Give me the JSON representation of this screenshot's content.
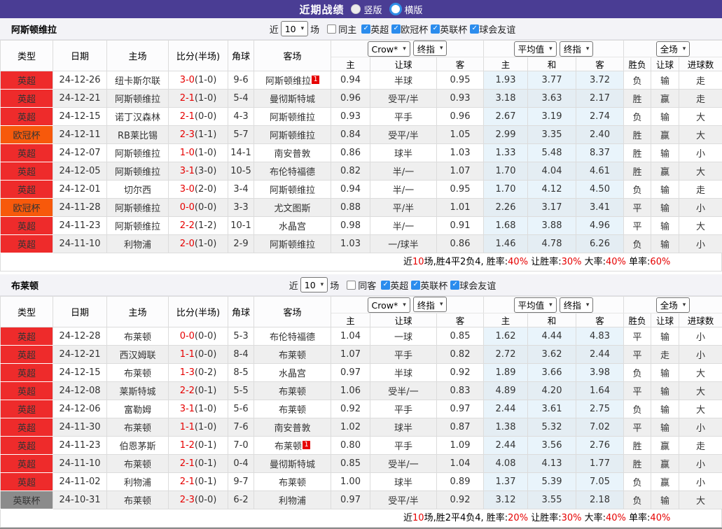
{
  "icons": {
    "check": "✓",
    "caret": "▾"
  },
  "colors": {
    "accent_purple": "#4a3d94",
    "league_red": "#ee2b2b",
    "league_orange": "#f7590b",
    "league_gray": "#8b8b8b",
    "team_highlight_green": "#2f9e2f",
    "score_red": "#e60000",
    "win_red": "#d43c3c",
    "lose_blue": "#3a3ad6",
    "draw_green": "#2e9b2e",
    "checkbox_blue": "#2b8ced"
  },
  "titlebar": {
    "title": "近期战绩",
    "radio_vertical": "竖版",
    "radio_horizontal": "横版"
  },
  "table_header": {
    "static_cols": [
      "类型",
      "日期",
      "主场",
      "比分(半场)",
      "角球",
      "客场"
    ],
    "crow_group": {
      "select1": "Crow*",
      "select2": "终指",
      "subcols": [
        "主",
        "让球",
        "客"
      ]
    },
    "avg_group": {
      "select1": "平均值",
      "select2": "终指",
      "subcols": [
        "主",
        "和",
        "客"
      ]
    },
    "result_group": {
      "select": "全场",
      "subcols": [
        "胜负",
        "让球",
        "进球数"
      ]
    }
  },
  "sections": [
    {
      "team": "阿斯顿维拉",
      "filter": {
        "prefix": "近",
        "match_count": "10",
        "suffix": "场",
        "same_label": "同主",
        "same_checked": false,
        "leagues": [
          {
            "label": "英超",
            "checked": true
          },
          {
            "label": "欧冠杯",
            "checked": true
          },
          {
            "label": "英联杯",
            "checked": true
          },
          {
            "label": "球会友谊",
            "checked": true
          }
        ]
      },
      "rows": [
        {
          "type": "英超",
          "style": "red",
          "date": "24-12-26",
          "home": "纽卡斯尔联",
          "home_green": false,
          "home_badge": null,
          "score": "3-0",
          "half": "(1-0)",
          "corner": "9-6",
          "away": "阿斯顿维拉",
          "away_green": true,
          "away_badge": "1",
          "crow": [
            "0.94",
            "半球",
            "0.95"
          ],
          "avg": [
            "1.93",
            "3.77",
            "3.72"
          ],
          "results": [
            [
              "负",
              "blue"
            ],
            [
              "输",
              "blue"
            ],
            [
              "走",
              "green"
            ]
          ]
        },
        {
          "type": "英超",
          "style": "red",
          "date": "24-12-21",
          "home": "阿斯顿维拉",
          "home_green": true,
          "home_badge": null,
          "score": "2-1",
          "half": "(1-0)",
          "corner": "5-4",
          "away": "曼彻斯特城",
          "away_green": false,
          "away_badge": null,
          "crow": [
            "0.96",
            "受平/半",
            "0.93"
          ],
          "avg": [
            "3.18",
            "3.63",
            "2.17"
          ],
          "results": [
            [
              "胜",
              "red"
            ],
            [
              "赢",
              "red"
            ],
            [
              "走",
              "green"
            ]
          ]
        },
        {
          "type": "英超",
          "style": "red",
          "date": "24-12-15",
          "home": "诺丁汉森林",
          "home_green": false,
          "home_badge": null,
          "score": "2-1",
          "half": "(0-0)",
          "corner": "4-3",
          "away": "阿斯顿维拉",
          "away_green": true,
          "away_badge": null,
          "crow": [
            "0.93",
            "平手",
            "0.96"
          ],
          "avg": [
            "2.67",
            "3.19",
            "2.74"
          ],
          "results": [
            [
              "负",
              "blue"
            ],
            [
              "输",
              "blue"
            ],
            [
              "大",
              "red"
            ]
          ]
        },
        {
          "type": "欧冠杯",
          "style": "orange",
          "date": "24-12-11",
          "home": "RB莱比锡",
          "home_green": false,
          "home_badge": null,
          "score": "2-3",
          "half": "(1-1)",
          "corner": "5-7",
          "away": "阿斯顿维拉",
          "away_green": true,
          "away_badge": null,
          "crow": [
            "0.84",
            "受平/半",
            "1.05"
          ],
          "avg": [
            "2.99",
            "3.35",
            "2.40"
          ],
          "results": [
            [
              "胜",
              "red"
            ],
            [
              "赢",
              "red"
            ],
            [
              "大",
              "red"
            ]
          ]
        },
        {
          "type": "英超",
          "style": "red",
          "date": "24-12-07",
          "home": "阿斯顿维拉",
          "home_green": true,
          "home_badge": null,
          "score": "1-0",
          "half": "(1-0)",
          "corner": "14-1",
          "away": "南安普敦",
          "away_green": false,
          "away_badge": null,
          "crow": [
            "0.86",
            "球半",
            "1.03"
          ],
          "avg": [
            "1.33",
            "5.48",
            "8.37"
          ],
          "results": [
            [
              "胜",
              "red"
            ],
            [
              "输",
              "blue"
            ],
            [
              "小",
              "blue"
            ]
          ]
        },
        {
          "type": "英超",
          "style": "red",
          "date": "24-12-05",
          "home": "阿斯顿维拉",
          "home_green": true,
          "home_badge": null,
          "score": "3-1",
          "half": "(3-0)",
          "corner": "10-5",
          "away": "布伦特福德",
          "away_green": false,
          "away_badge": null,
          "crow": [
            "0.82",
            "半/一",
            "1.07"
          ],
          "avg": [
            "1.70",
            "4.04",
            "4.61"
          ],
          "results": [
            [
              "胜",
              "red"
            ],
            [
              "赢",
              "red"
            ],
            [
              "大",
              "red"
            ]
          ]
        },
        {
          "type": "英超",
          "style": "red",
          "date": "24-12-01",
          "home": "切尔西",
          "home_green": false,
          "home_badge": null,
          "score": "3-0",
          "half": "(2-0)",
          "corner": "3-4",
          "away": "阿斯顿维拉",
          "away_green": true,
          "away_badge": null,
          "crow": [
            "0.94",
            "半/一",
            "0.95"
          ],
          "avg": [
            "1.70",
            "4.12",
            "4.50"
          ],
          "results": [
            [
              "负",
              "blue"
            ],
            [
              "输",
              "blue"
            ],
            [
              "走",
              "green"
            ]
          ]
        },
        {
          "type": "欧冠杯",
          "style": "orange",
          "date": "24-11-28",
          "home": "阿斯顿维拉",
          "home_green": true,
          "home_badge": null,
          "score": "0-0",
          "half": "(0-0)",
          "corner": "3-3",
          "away": "尤文图斯",
          "away_green": false,
          "away_badge": null,
          "crow": [
            "0.88",
            "平/半",
            "1.01"
          ],
          "avg": [
            "2.26",
            "3.17",
            "3.41"
          ],
          "results": [
            [
              "平",
              "green"
            ],
            [
              "输",
              "blue"
            ],
            [
              "小",
              "blue"
            ]
          ]
        },
        {
          "type": "英超",
          "style": "red",
          "date": "24-11-23",
          "home": "阿斯顿维拉",
          "home_green": true,
          "home_badge": null,
          "score": "2-2",
          "half": "(1-2)",
          "corner": "10-1",
          "away": "水晶宫",
          "away_green": false,
          "away_badge": null,
          "crow": [
            "0.98",
            "半/一",
            "0.91"
          ],
          "avg": [
            "1.68",
            "3.88",
            "4.96"
          ],
          "results": [
            [
              "平",
              "green"
            ],
            [
              "输",
              "blue"
            ],
            [
              "大",
              "red"
            ]
          ]
        },
        {
          "type": "英超",
          "style": "red",
          "date": "24-11-10",
          "home": "利物浦",
          "home_green": false,
          "home_badge": null,
          "score": "2-0",
          "half": "(1-0)",
          "corner": "2-9",
          "away": "阿斯顿维拉",
          "away_green": true,
          "away_badge": null,
          "crow": [
            "1.03",
            "一/球半",
            "0.86"
          ],
          "avg": [
            "1.46",
            "4.78",
            "6.26"
          ],
          "results": [
            [
              "负",
              "blue"
            ],
            [
              "输",
              "blue"
            ],
            [
              "小",
              "blue"
            ]
          ]
        }
      ],
      "summary": [
        [
          "近",
          "k"
        ],
        [
          "10",
          "r"
        ],
        [
          "场,胜4平2负4, 胜率:",
          "k"
        ],
        [
          "40%",
          "r"
        ],
        [
          " 让胜率:",
          "k"
        ],
        [
          "30%",
          "r"
        ],
        [
          " 大率:",
          "k"
        ],
        [
          "40%",
          "r"
        ],
        [
          " 单率:",
          "k"
        ],
        [
          "60%",
          "r"
        ]
      ]
    },
    {
      "team": "布莱顿",
      "filter": {
        "prefix": "近",
        "match_count": "10",
        "suffix": "场",
        "same_label": "同客",
        "same_checked": false,
        "leagues": [
          {
            "label": "英超",
            "checked": true
          },
          {
            "label": "英联杯",
            "checked": true
          },
          {
            "label": "球会友谊",
            "checked": true
          }
        ]
      },
      "rows": [
        {
          "type": "英超",
          "style": "red",
          "date": "24-12-28",
          "home": "布莱顿",
          "home_green": true,
          "home_badge": null,
          "score": "0-0",
          "half": "(0-0)",
          "corner": "5-3",
          "away": "布伦特福德",
          "away_green": false,
          "away_badge": null,
          "crow": [
            "1.04",
            "一球",
            "0.85"
          ],
          "avg": [
            "1.62",
            "4.44",
            "4.83"
          ],
          "results": [
            [
              "平",
              "green"
            ],
            [
              "输",
              "blue"
            ],
            [
              "小",
              "blue"
            ]
          ]
        },
        {
          "type": "英超",
          "style": "red",
          "date": "24-12-21",
          "home": "西汉姆联",
          "home_green": false,
          "home_badge": null,
          "score": "1-1",
          "half": "(0-0)",
          "corner": "8-4",
          "away": "布莱顿",
          "away_green": true,
          "away_badge": null,
          "crow": [
            "1.07",
            "平手",
            "0.82"
          ],
          "avg": [
            "2.72",
            "3.62",
            "2.44"
          ],
          "results": [
            [
              "平",
              "green"
            ],
            [
              "走",
              "green"
            ],
            [
              "小",
              "blue"
            ]
          ]
        },
        {
          "type": "英超",
          "style": "red",
          "date": "24-12-15",
          "home": "布莱顿",
          "home_green": true,
          "home_badge": null,
          "score": "1-3",
          "half": "(0-2)",
          "corner": "8-5",
          "away": "水晶宫",
          "away_green": false,
          "away_badge": null,
          "crow": [
            "0.97",
            "半球",
            "0.92"
          ],
          "avg": [
            "1.89",
            "3.66",
            "3.98"
          ],
          "results": [
            [
              "负",
              "blue"
            ],
            [
              "输",
              "blue"
            ],
            [
              "大",
              "red"
            ]
          ]
        },
        {
          "type": "英超",
          "style": "red",
          "date": "24-12-08",
          "home": "莱斯特城",
          "home_green": false,
          "home_badge": null,
          "score": "2-2",
          "half": "(0-1)",
          "corner": "5-5",
          "away": "布莱顿",
          "away_green": true,
          "away_badge": null,
          "crow": [
            "1.06",
            "受半/一",
            "0.83"
          ],
          "avg": [
            "4.89",
            "4.20",
            "1.64"
          ],
          "results": [
            [
              "平",
              "green"
            ],
            [
              "输",
              "blue"
            ],
            [
              "大",
              "red"
            ]
          ]
        },
        {
          "type": "英超",
          "style": "red",
          "date": "24-12-06",
          "home": "富勒姆",
          "home_green": false,
          "home_badge": null,
          "score": "3-1",
          "half": "(1-0)",
          "corner": "5-6",
          "away": "布莱顿",
          "away_green": true,
          "away_badge": null,
          "crow": [
            "0.92",
            "平手",
            "0.97"
          ],
          "avg": [
            "2.44",
            "3.61",
            "2.75"
          ],
          "results": [
            [
              "负",
              "blue"
            ],
            [
              "输",
              "blue"
            ],
            [
              "大",
              "red"
            ]
          ]
        },
        {
          "type": "英超",
          "style": "red",
          "date": "24-11-30",
          "home": "布莱顿",
          "home_green": true,
          "home_badge": null,
          "score": "1-1",
          "half": "(1-0)",
          "corner": "7-6",
          "away": "南安普敦",
          "away_green": false,
          "away_badge": null,
          "crow": [
            "1.02",
            "球半",
            "0.87"
          ],
          "avg": [
            "1.38",
            "5.32",
            "7.02"
          ],
          "results": [
            [
              "平",
              "green"
            ],
            [
              "输",
              "blue"
            ],
            [
              "小",
              "blue"
            ]
          ]
        },
        {
          "type": "英超",
          "style": "red",
          "date": "24-11-23",
          "home": "伯恩茅斯",
          "home_green": false,
          "home_badge": null,
          "score": "1-2",
          "half": "(0-1)",
          "corner": "7-0",
          "away": "布莱顿",
          "away_green": true,
          "away_badge": "1",
          "crow": [
            "0.80",
            "平手",
            "1.09"
          ],
          "avg": [
            "2.44",
            "3.56",
            "2.76"
          ],
          "results": [
            [
              "胜",
              "red"
            ],
            [
              "赢",
              "red"
            ],
            [
              "走",
              "green"
            ]
          ]
        },
        {
          "type": "英超",
          "style": "red",
          "date": "24-11-10",
          "home": "布莱顿",
          "home_green": true,
          "home_badge": null,
          "score": "2-1",
          "half": "(0-1)",
          "corner": "0-4",
          "away": "曼彻斯特城",
          "away_green": false,
          "away_badge": null,
          "crow": [
            "0.85",
            "受半/一",
            "1.04"
          ],
          "avg": [
            "4.08",
            "4.13",
            "1.77"
          ],
          "results": [
            [
              "胜",
              "red"
            ],
            [
              "赢",
              "red"
            ],
            [
              "小",
              "blue"
            ]
          ]
        },
        {
          "type": "英超",
          "style": "red",
          "date": "24-11-02",
          "home": "利物浦",
          "home_green": false,
          "home_badge": null,
          "score": "2-1",
          "half": "(0-1)",
          "corner": "9-7",
          "away": "布莱顿",
          "away_green": true,
          "away_badge": null,
          "crow": [
            "1.00",
            "球半",
            "0.89"
          ],
          "avg": [
            "1.37",
            "5.39",
            "7.05"
          ],
          "results": [
            [
              "负",
              "blue"
            ],
            [
              "赢",
              "red"
            ],
            [
              "小",
              "blue"
            ]
          ]
        },
        {
          "type": "英联杯",
          "style": "gray",
          "date": "24-10-31",
          "home": "布莱顿",
          "home_green": true,
          "home_badge": null,
          "score": "2-3",
          "half": "(0-0)",
          "corner": "6-2",
          "away": "利物浦",
          "away_green": false,
          "away_badge": null,
          "crow": [
            "0.97",
            "受平/半",
            "0.92"
          ],
          "avg": [
            "3.12",
            "3.55",
            "2.18"
          ],
          "results": [
            [
              "负",
              "blue"
            ],
            [
              "输",
              "blue"
            ],
            [
              "大",
              "red"
            ]
          ]
        }
      ],
      "summary": [
        [
          "近",
          "k"
        ],
        [
          "10",
          "r"
        ],
        [
          "场,胜2平4负4, 胜率:",
          "k"
        ],
        [
          "20%",
          "r"
        ],
        [
          " 让胜率:",
          "k"
        ],
        [
          "30%",
          "r"
        ],
        [
          " 大率:",
          "k"
        ],
        [
          "40%",
          "r"
        ],
        [
          " 单率:",
          "k"
        ],
        [
          "40%",
          "r"
        ]
      ]
    }
  ]
}
